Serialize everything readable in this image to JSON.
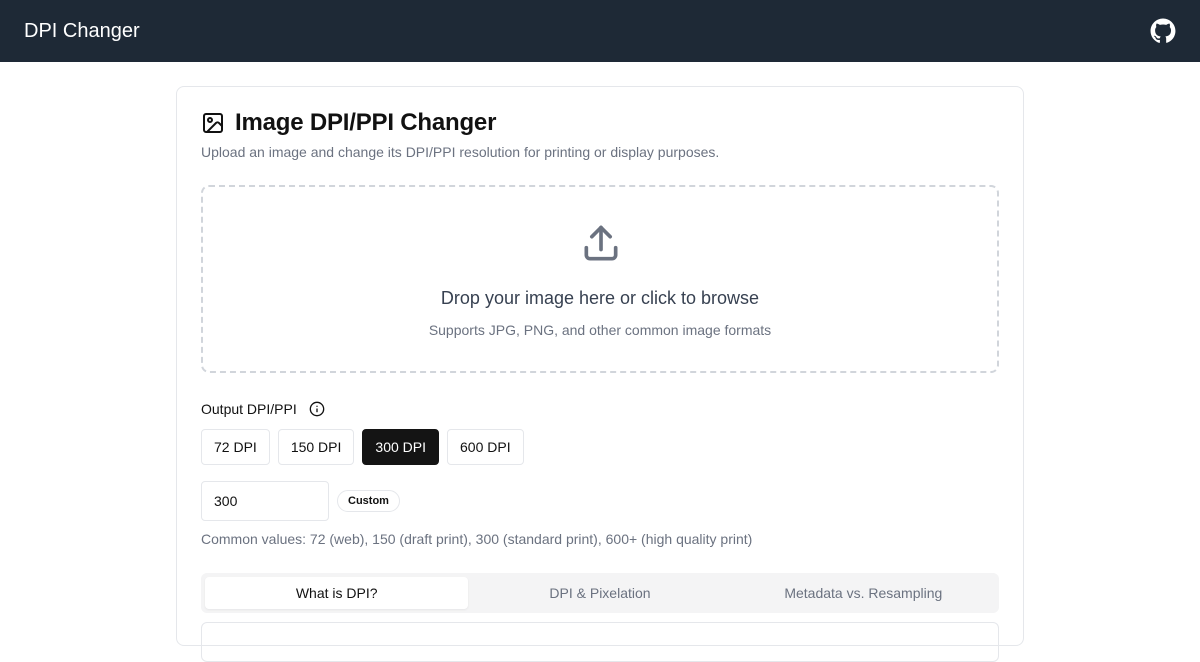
{
  "app": {
    "title": "DPI Changer"
  },
  "card": {
    "title": "Image DPI/PPI Changer",
    "subtitle": "Upload an image and change its DPI/PPI resolution for printing or display purposes."
  },
  "dropzone": {
    "title": "Drop your image here or click to browse",
    "subtitle": "Supports JPG, PNG, and other common image formats"
  },
  "dpi": {
    "label": "Output DPI/PPI",
    "presets": [
      {
        "label": "72 DPI",
        "active": false
      },
      {
        "label": "150 DPI",
        "active": false
      },
      {
        "label": "300 DPI",
        "active": true
      },
      {
        "label": "600 DPI",
        "active": false
      }
    ],
    "value": "300",
    "badge": "Custom",
    "hint": "Common values: 72 (web), 150 (draft print), 300 (standard print), 600+ (high quality print)"
  },
  "tabs": [
    {
      "label": "What is DPI?",
      "active": true
    },
    {
      "label": "DPI & Pixelation",
      "active": false
    },
    {
      "label": "Metadata vs. Resampling",
      "active": false
    }
  ],
  "icons": {
    "header": "github-icon",
    "title": "image-icon",
    "dropzone": "upload-icon",
    "label": "info-icon"
  },
  "colors": {
    "header_bg": "#1e2936",
    "active_button": "#141414",
    "muted_text": "#6b7280",
    "border": "#e5e7eb"
  }
}
